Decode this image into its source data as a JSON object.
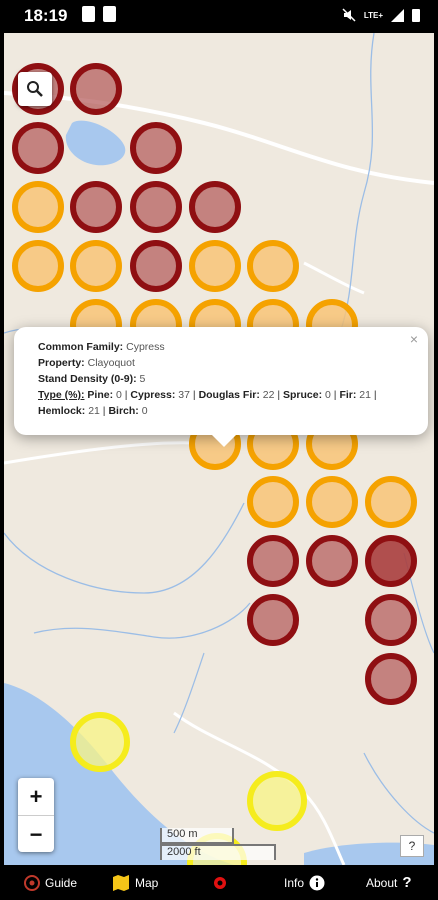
{
  "status_bar": {
    "time": "18:19",
    "network": "LTE+"
  },
  "popup": {
    "close": "×",
    "common_family_label": "Common Family:",
    "common_family_value": "Cypress",
    "property_label": "Property:",
    "property_value": "Clayoquot",
    "stand_density_label": "Stand Density (0-9):",
    "stand_density_value": "5",
    "type_label": "Type (%):",
    "pine_label": "Pine:",
    "pine_value": "0",
    "cypress_label": "Cypress:",
    "cypress_value": "37",
    "douglas_label": "Douglas Fir:",
    "douglas_value": "22",
    "spruce_label": "Spruce:",
    "spruce_value": "0",
    "fir_label": "Fir:",
    "fir_value": "21",
    "hemlock_label": "Hemlock:",
    "hemlock_value": "21",
    "birch_label": "Birch:",
    "birch_value": "0",
    "sep": "|"
  },
  "map_controls": {
    "zoom_in": "+",
    "zoom_out": "−",
    "help": "?"
  },
  "scale": {
    "metric": "500 m",
    "imperial": "2000 ft"
  },
  "nav": {
    "guide": "Guide",
    "map": "Map",
    "info": "Info",
    "about": "About"
  },
  "colors": {
    "high": "#8f0f12",
    "medium": "#f5a200",
    "low": "#f5ec1d",
    "water": "#a8c8ee"
  }
}
